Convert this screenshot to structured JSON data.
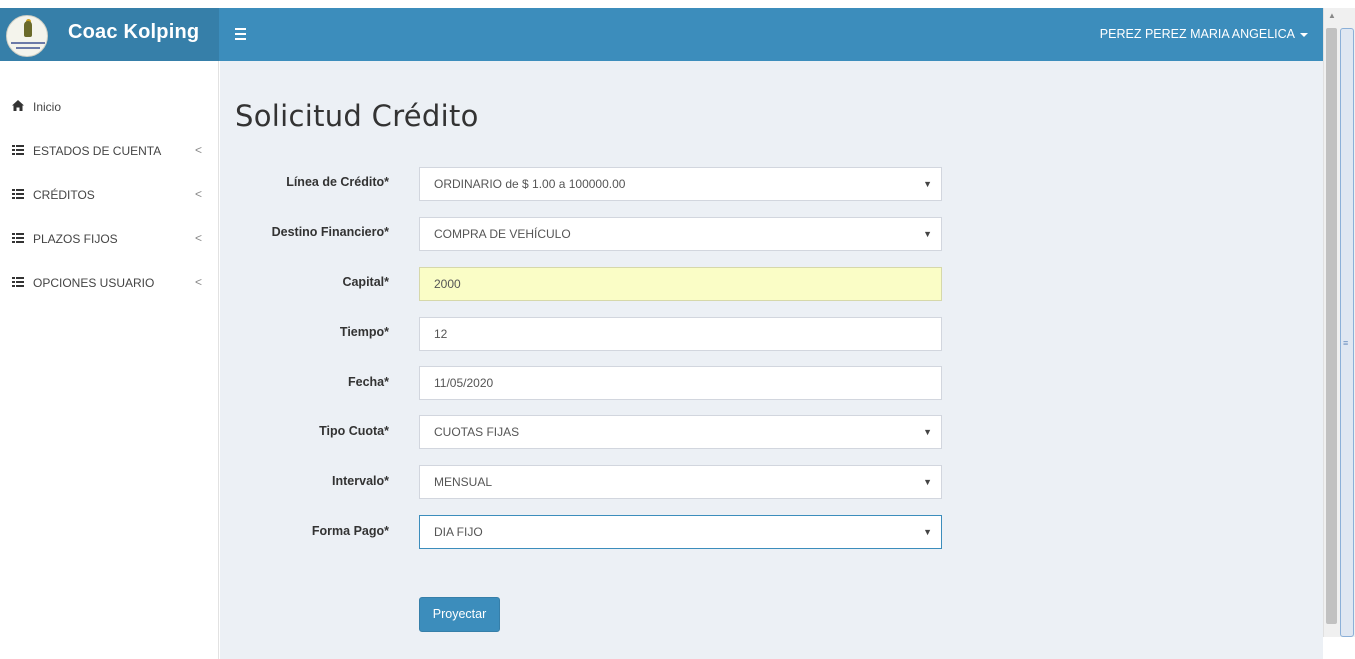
{
  "header": {
    "brand": "Coac Kolping",
    "user_name": "PEREZ PEREZ MARIA ANGELICA",
    "accent_color": "#3c8dbc"
  },
  "sidebar": {
    "items": [
      {
        "label": "Inicio",
        "icon": "home-icon"
      },
      {
        "label": "ESTADOS DE CUENTA",
        "icon": "list-icon",
        "chevron": "<"
      },
      {
        "label": "CRÉDITOS",
        "icon": "list-icon",
        "chevron": "<"
      },
      {
        "label": "PLAZOS FIJOS",
        "icon": "list-icon",
        "chevron": "<"
      },
      {
        "label": "OPCIONES USUARIO",
        "icon": "list-icon",
        "chevron": "<"
      }
    ]
  },
  "main": {
    "title": "Solicitud Crédito",
    "fields": {
      "linea": {
        "label": "Línea de Crédito*",
        "value": "ORDINARIO de $ 1.00 a 100000.00"
      },
      "destino": {
        "label": "Destino Financiero*",
        "value": "COMPRA DE VEHÍCULO"
      },
      "capital": {
        "label": "Capital*",
        "value": "2000"
      },
      "tiempo": {
        "label": "Tiempo*",
        "value": "12"
      },
      "fecha": {
        "label": "Fecha*",
        "value": "11/05/2020"
      },
      "tipo_cuota": {
        "label": "Tipo Cuota*",
        "value": "CUOTAS FIJAS"
      },
      "intervalo": {
        "label": "Intervalo*",
        "value": "MENSUAL"
      },
      "forma_pago": {
        "label": "Forma Pago*",
        "value": "DIA FIJO"
      }
    },
    "submit_label": "Proyectar"
  }
}
